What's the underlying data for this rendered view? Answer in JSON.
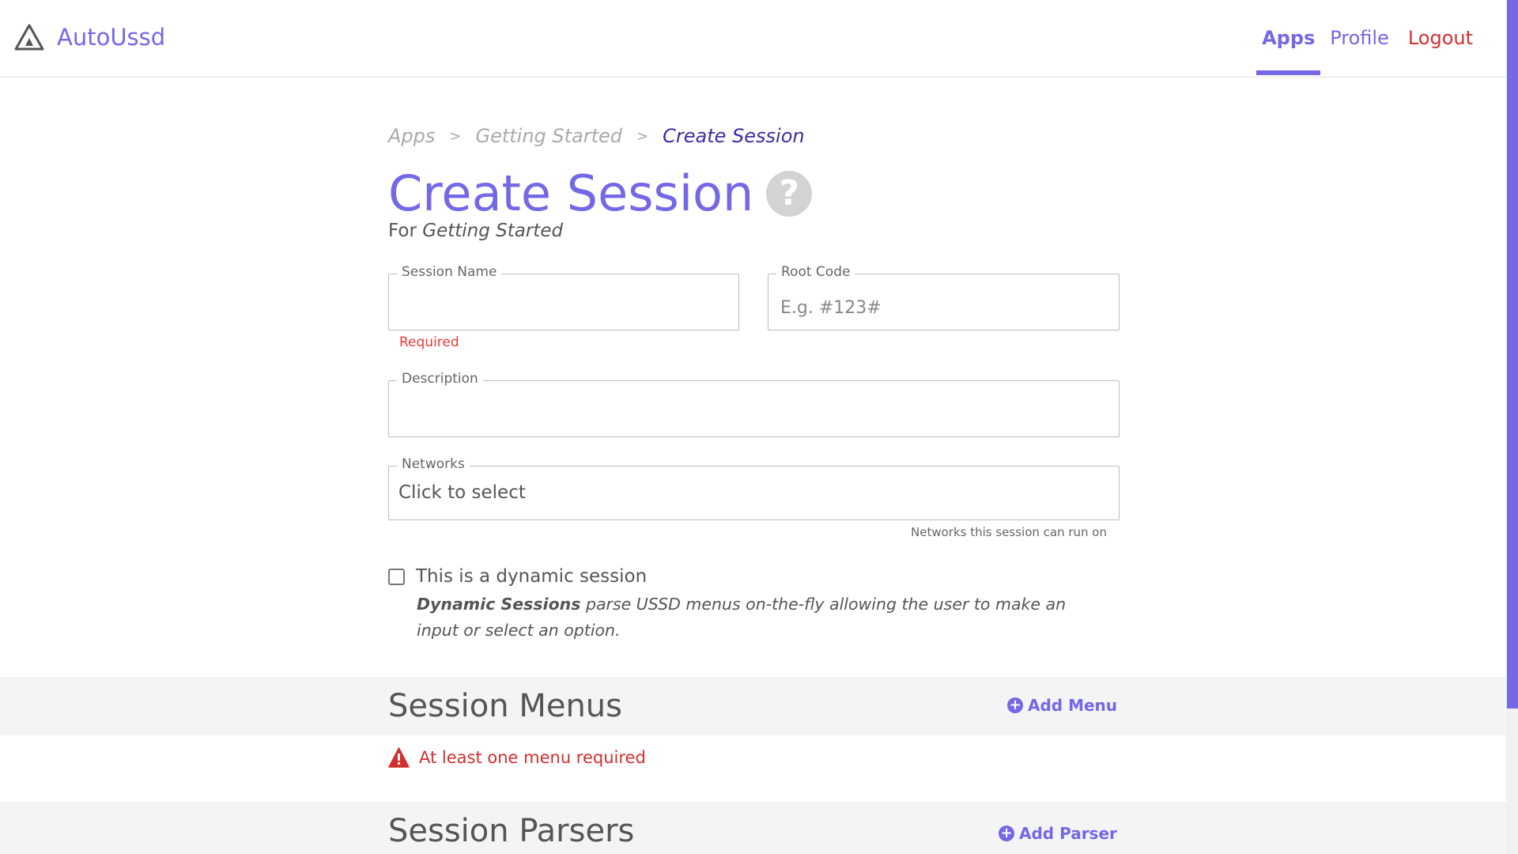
{
  "header": {
    "brand": "AutoUssd",
    "nav": {
      "apps": "Apps",
      "profile": "Profile",
      "logout": "Logout"
    }
  },
  "breadcrumb": {
    "items": [
      "Apps",
      "Getting Started",
      "Create Session"
    ],
    "separator": ">"
  },
  "page": {
    "title": "Create Session",
    "help_symbol": "?",
    "subtitle_prefix": "For",
    "subtitle_app": "Getting Started"
  },
  "form": {
    "session_name": {
      "label": "Session Name",
      "value": "",
      "error": "Required"
    },
    "root_code": {
      "label": "Root Code",
      "value": "",
      "placeholder": "E.g. #123#"
    },
    "description": {
      "label": "Description",
      "value": ""
    },
    "networks": {
      "label": "Networks",
      "value": "Click to select",
      "hint": "Networks this session can run on"
    },
    "dynamic": {
      "checked": false,
      "label": "This is a dynamic session",
      "desc_bold": "Dynamic Sessions",
      "desc_rest": " parse USSD menus on-the-fly allowing the user to make an input or select an option."
    }
  },
  "sections": {
    "menus": {
      "title": "Session Menus",
      "add_label": "Add Menu",
      "warning": "At least one menu required"
    },
    "parsers": {
      "title": "Session Parsers",
      "add_label": "Add Parser"
    }
  },
  "colors": {
    "accent": "#7468e6",
    "danger": "#d32f2f",
    "band": "#f4f4f4"
  },
  "icons": {
    "logo": "triangle-logo-icon",
    "help": "question-circle-icon",
    "add": "plus-circle-icon",
    "warning": "warning-triangle-icon"
  }
}
